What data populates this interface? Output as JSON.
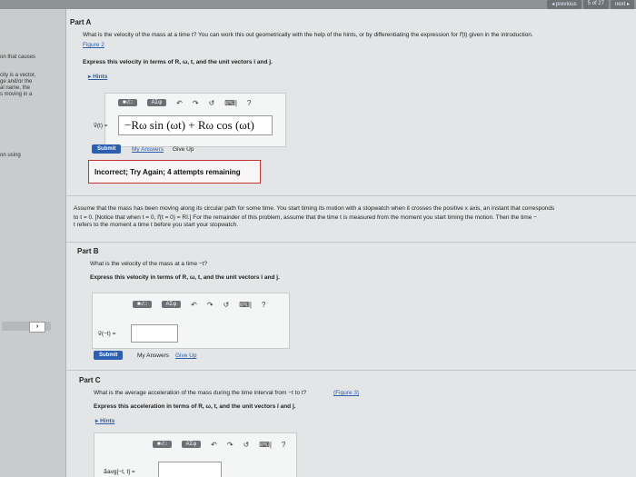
{
  "pager": {
    "previous": "◂ previous",
    "position": "5 of 27",
    "next": "next ▸"
  },
  "sidebar": {
    "text1": "on that causes",
    "text2": "city is a vector,\nge and/or the\nal name, the\ns moving in a",
    "text3": "on using",
    "nav_arrow": "›"
  },
  "part_a": {
    "title": "Part A",
    "question": "What is the velocity of the mass at a time t? You can work this out geometrically with the help of the hints, or by differentiating the expression for r⃗(t) given in the introduction.",
    "figure_link": "Figure 2",
    "instruction": "Express this velocity in terms of R, ω, t, and the unit vectors î and ĵ.",
    "hints": "▸ Hints",
    "toolbar": {
      "matrix": "■√□",
      "greek": "ΑΣφ",
      "undo": "↶",
      "redo": "↷",
      "reset": "↺",
      "keyboard": "⌨|",
      "help": "?"
    },
    "input_label": "v⃗(t) =",
    "answer": "−Rω sin (ωt) + Rω cos (ωt)",
    "submit": "Submit",
    "my_answers": "My Answers",
    "give_up": "Give Up",
    "feedback": "Incorrect; Try Again; 4 attempts remaining"
  },
  "assume": {
    "line1": "Assume that the mass has been moving along its circular path for some time. You start timing its motion with a stopwatch when it crosses the positive x axis, an instant that corresponds",
    "line2": "to t = 0. [Notice that when t = 0, r⃗(t = 0) = Rî.] For the remainder of this problem, assume that the time t is measured from the moment you start timing the motion. Then the time −",
    "line3": "t refers to the moment a time t before you start your stopwatch."
  },
  "part_b": {
    "title": "Part B",
    "question": "What is the velocity of the mass at a time −t?",
    "instruction": "Express this velocity in terms of R, ω, t, and the unit vectors î and ĵ.",
    "toolbar": {
      "matrix": "■√□",
      "greek": "ΑΣφ",
      "undo": "↶",
      "redo": "↷",
      "reset": "↺",
      "keyboard": "⌨|",
      "help": "?"
    },
    "input_label": "v⃗(−t) =",
    "answer": "",
    "submit": "Submit",
    "my_answers": "My Answers",
    "give_up": "Give Up"
  },
  "part_c": {
    "title": "Part C",
    "question": "What is the average acceleration of the mass during the time interval from −t to t?",
    "figure_link": "(Figure 3)",
    "instruction": "Express this acceleration in terms of R, ω, t, and the unit vectors î and ĵ.",
    "hints": "▸ Hints",
    "toolbar": {
      "matrix": "■√□",
      "greek": "ΑΣφ",
      "undo": "↶",
      "redo": "↷",
      "reset": "↺",
      "keyboard": "⌨|",
      "help": "?"
    },
    "input_label": "a⃗avg[−t, t] =",
    "answer": ""
  }
}
